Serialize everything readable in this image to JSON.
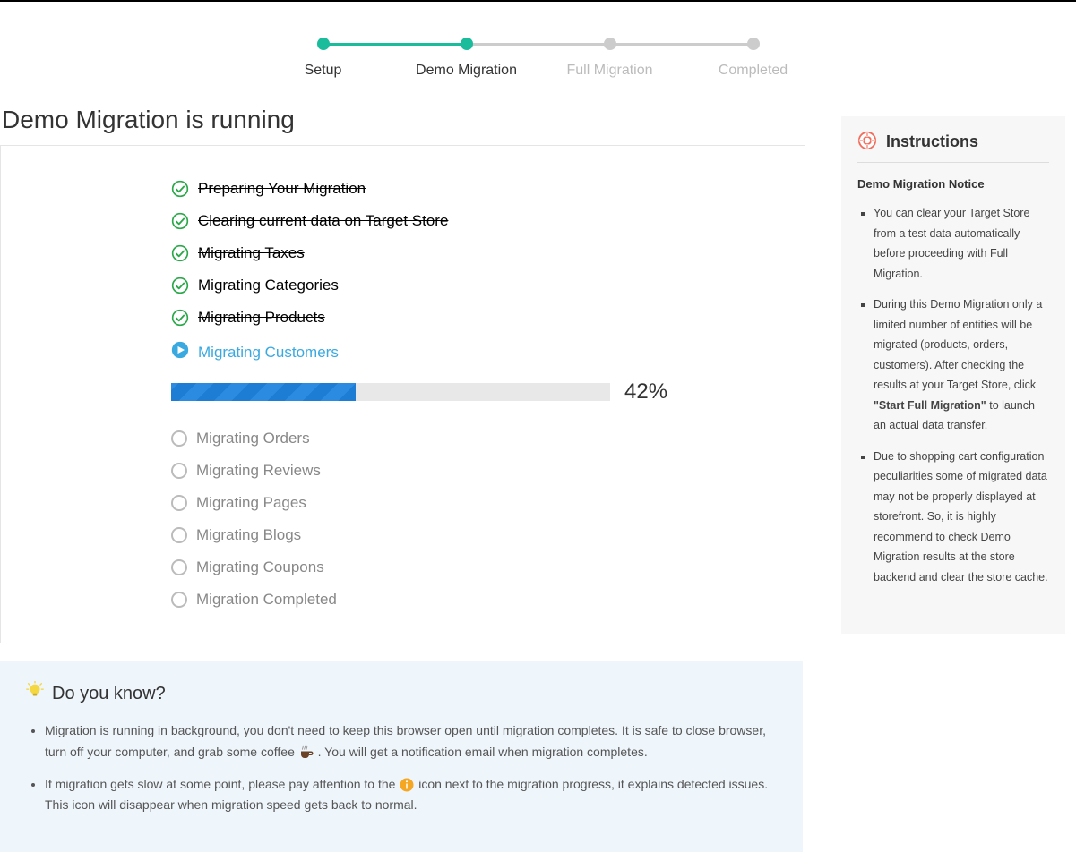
{
  "stepper": {
    "steps": [
      {
        "label": "Setup",
        "active": true
      },
      {
        "label": "Demo Migration",
        "active": true
      },
      {
        "label": "Full Migration",
        "active": false
      },
      {
        "label": "Completed",
        "active": false
      }
    ]
  },
  "page": {
    "title": "Demo Migration is running"
  },
  "tasks": {
    "done": [
      "Preparing Your Migration",
      "Clearing current data on Target Store",
      "Migrating Taxes",
      "Migrating Categories",
      "Migrating Products"
    ],
    "current": {
      "label": "Migrating Customers",
      "percent": 42,
      "percent_text": "42%"
    },
    "pending": [
      "Migrating Orders",
      "Migrating Reviews",
      "Migrating Pages",
      "Migrating Blogs",
      "Migrating Coupons",
      "Migration Completed"
    ]
  },
  "sidebar": {
    "title": "Instructions",
    "notice_title": "Demo Migration Notice",
    "items": {
      "item0": "You can clear your Target Store from a test data automatically before proceeding with Full Migration.",
      "item1_pre": "During this Demo Migration only a limited number of entities will be migrated (products, orders, customers). After checking the results at your Target Store, click ",
      "item1_bold": "\"Start Full Migration\"",
      "item1_post": " to launch an actual data transfer.",
      "item2": "Due to shopping cart configuration peculiarities some of migrated data may not be properly displayed at storefront. So, it is highly recommend to check Demo Migration results at the store backend and clear the store cache."
    }
  },
  "tip": {
    "title": "Do you know?",
    "item0_pre": "Migration is running in background, you don't need to keep this browser open until migration completes. It is safe to close browser, turn off your computer, and grab some coffee ",
    "item0_post": " . You will get a notification email when migration completes.",
    "item1_pre": "If migration gets slow at some point, please pay attention to the ",
    "item1_post": " icon next to the migration progress, it explains detected issues. This icon will disappear when migration speed gets back to normal."
  },
  "icons": {
    "check": "check-icon",
    "play": "play-icon",
    "circle": "circle-icon",
    "lifering": "lifering-icon",
    "bulb": "bulb-icon",
    "coffee": "coffee-icon",
    "info": "info-icon"
  },
  "colors": {
    "accent_green": "#1abc9c",
    "accent_blue": "#3aa9e0",
    "progress_blue": "#1d7dd4",
    "tip_bg": "#eef5fb"
  }
}
